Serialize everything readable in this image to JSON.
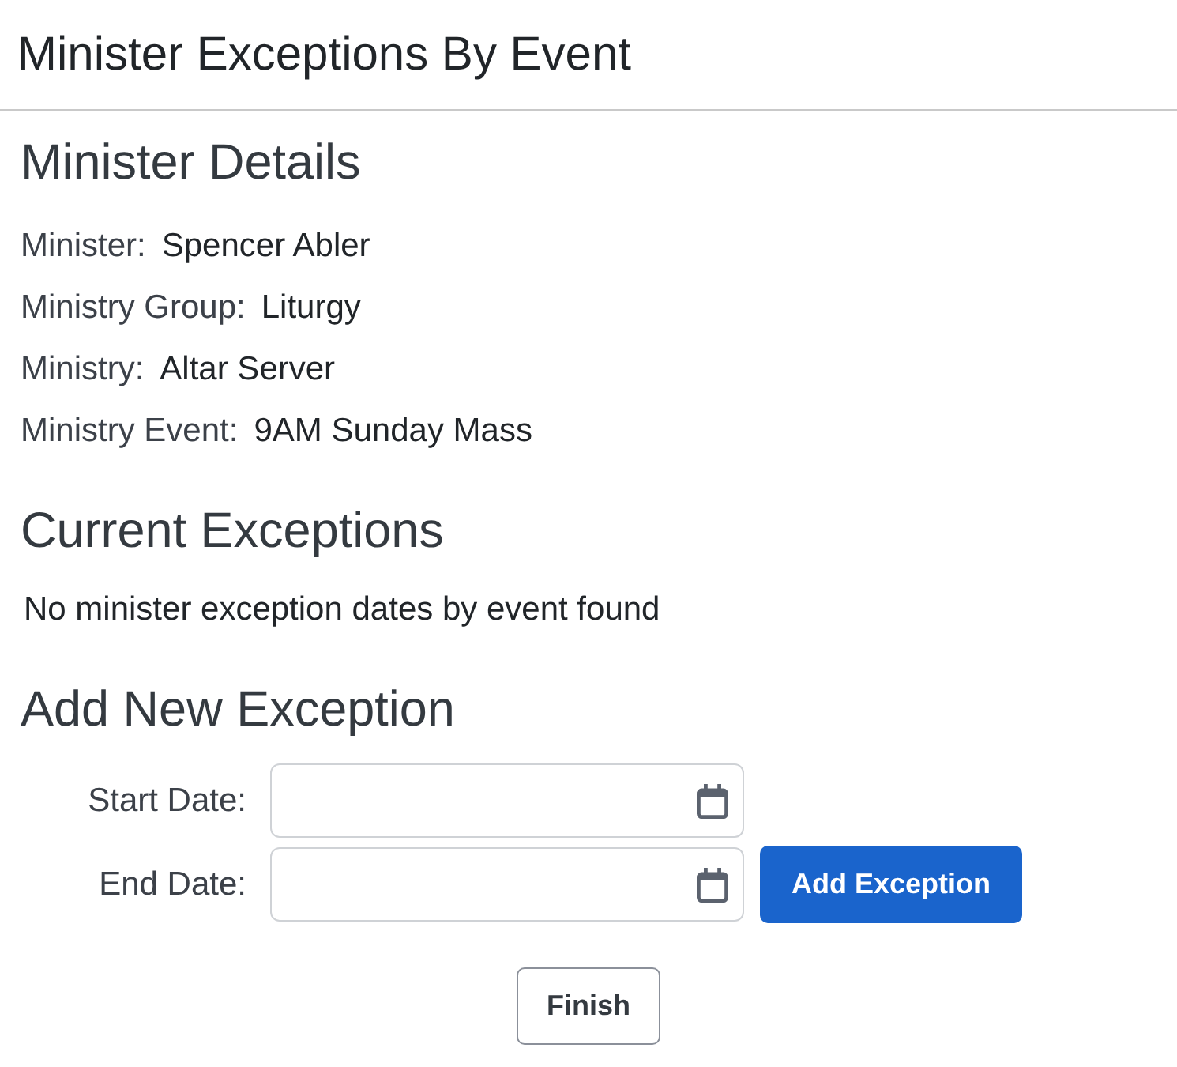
{
  "header": {
    "title": "Minister Exceptions By Event"
  },
  "details": {
    "heading": "Minister Details",
    "fields": [
      {
        "label": "Minister:",
        "value": "Spencer Abler"
      },
      {
        "label": "Ministry Group:",
        "value": "Liturgy"
      },
      {
        "label": "Ministry:",
        "value": "Altar Server"
      },
      {
        "label": "Ministry Event:",
        "value": "9AM Sunday Mass"
      }
    ]
  },
  "current_exceptions": {
    "heading": "Current Exceptions",
    "empty_message": "No minister exception dates by event found"
  },
  "add_exception": {
    "heading": "Add New Exception",
    "fields": [
      {
        "label": "Start Date:"
      },
      {
        "label": "End Date:"
      }
    ],
    "add_button": "Add Exception"
  },
  "finish_button": "Finish"
}
